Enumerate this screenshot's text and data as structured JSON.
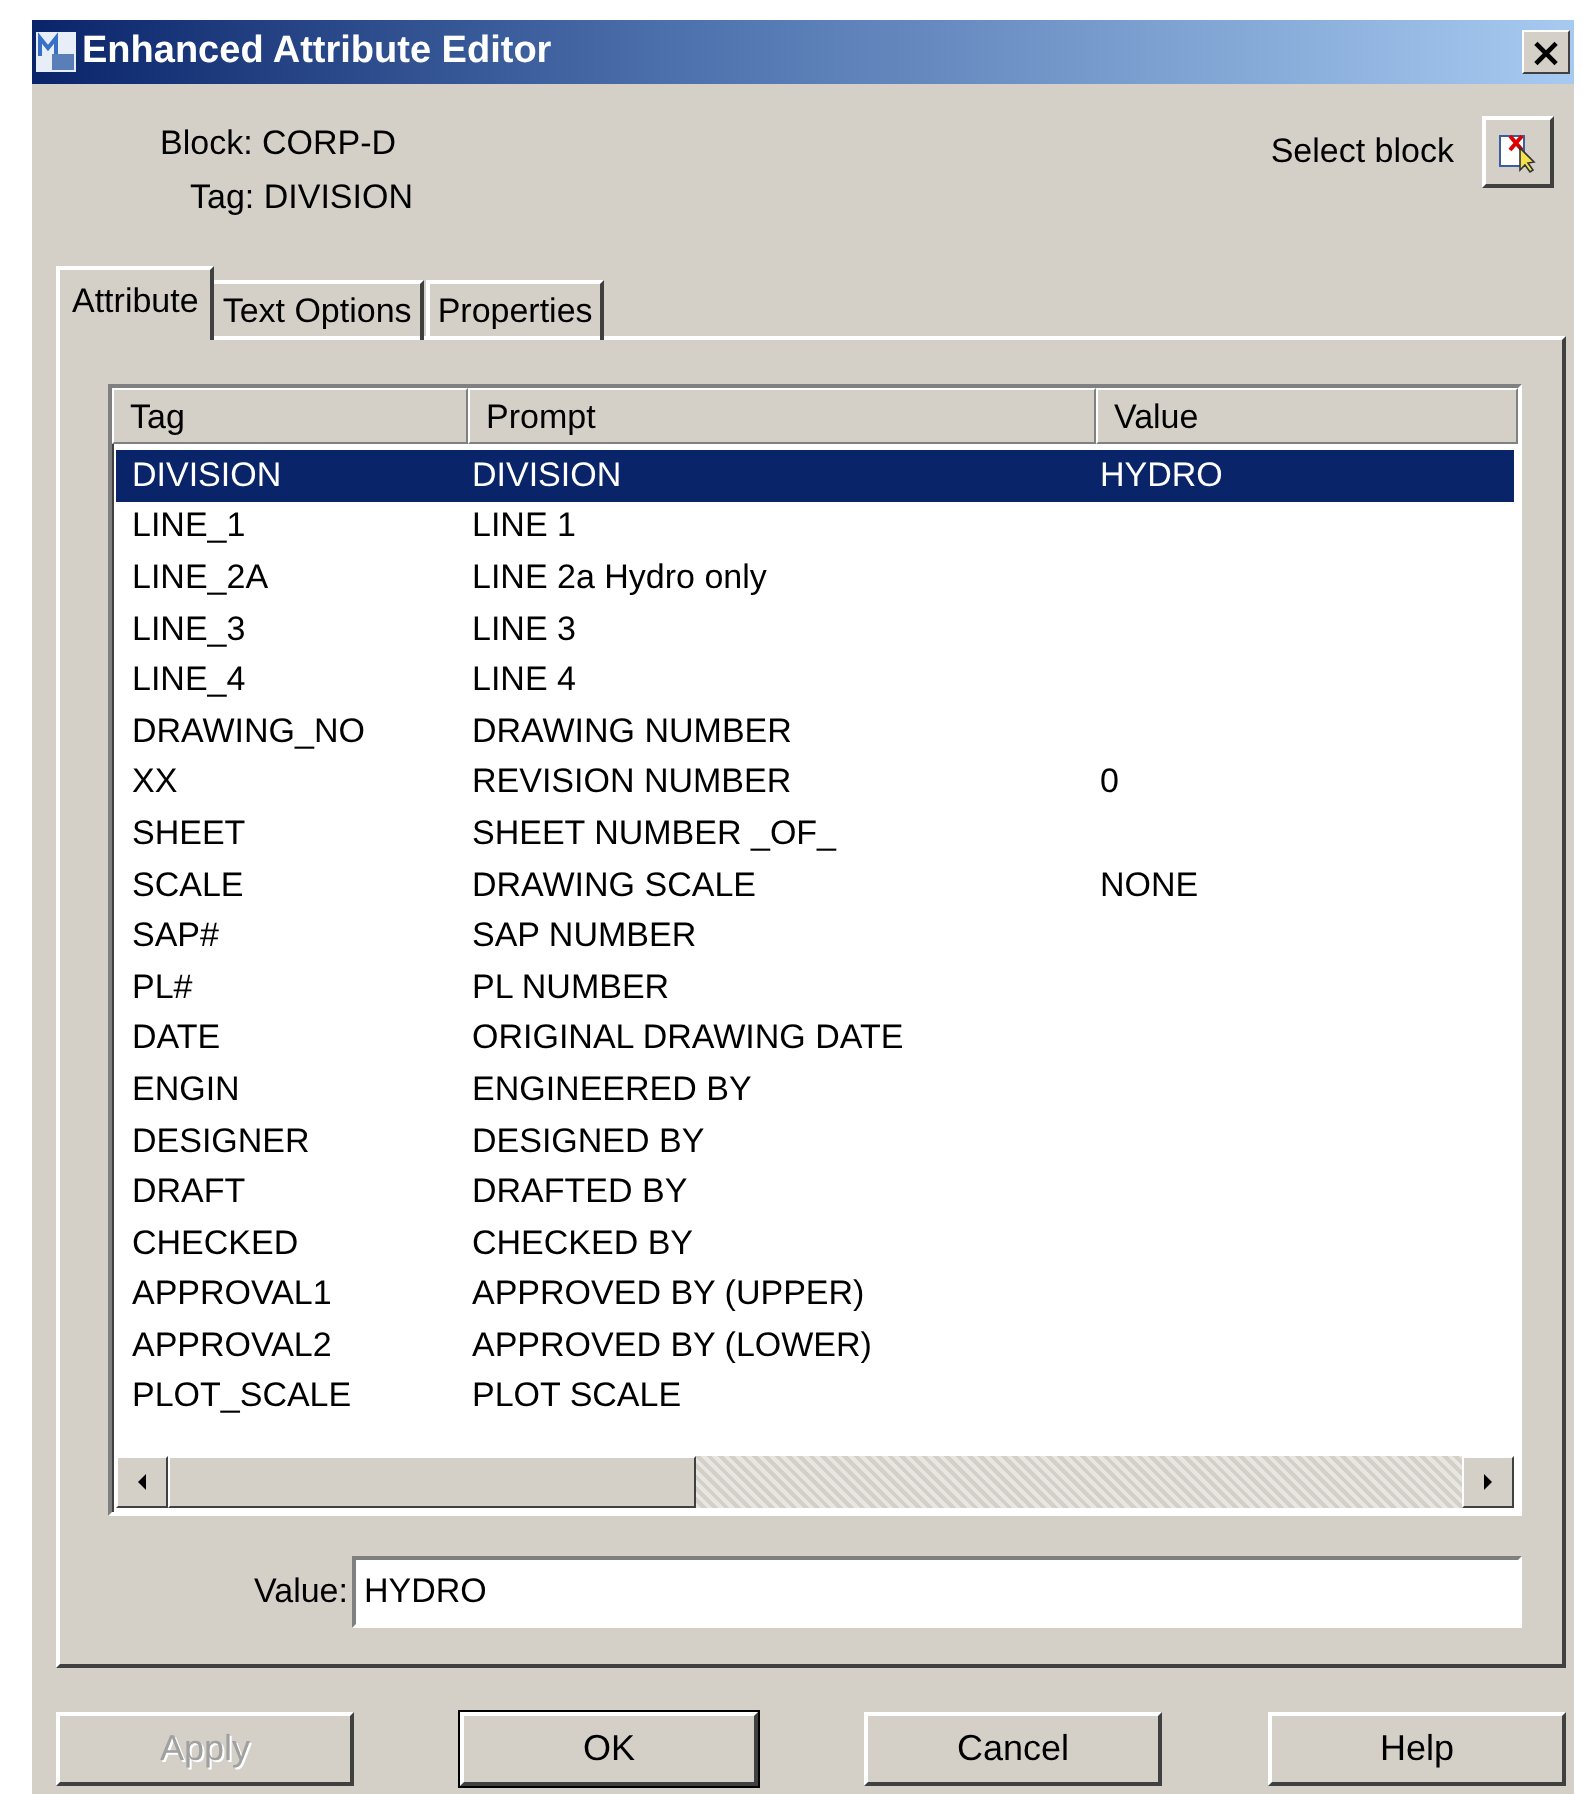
{
  "window": {
    "title": "Enhanced Attribute Editor",
    "close": "×"
  },
  "block": {
    "block_label": "Block: CORP-D",
    "tag_label": "Tag: DIVISION"
  },
  "select_block": {
    "label": "Select block"
  },
  "tabs": [
    {
      "label": "Attribute",
      "selected": true
    },
    {
      "label": "Text Options",
      "selected": false
    },
    {
      "label": "Properties",
      "selected": false
    }
  ],
  "table": {
    "columns": [
      "Tag",
      "Prompt",
      "Value"
    ],
    "rows": [
      {
        "tag": "DIVISION",
        "prompt": "DIVISION",
        "value": "HYDRO",
        "selected": true
      },
      {
        "tag": "LINE_1",
        "prompt": "LINE 1",
        "selected": false
      },
      {
        "tag": "LINE_2A",
        "prompt": "LINE 2a Hydro only",
        "selected": false
      },
      {
        "tag": "LINE_3",
        "prompt": "LINE 3",
        "selected": false
      },
      {
        "tag": "LINE_4",
        "prompt": "LINE 4",
        "selected": false
      },
      {
        "tag": "DRAWING_NO",
        "prompt": "DRAWING NUMBER",
        "selected": false
      },
      {
        "tag": "XX",
        "prompt": "REVISION NUMBER",
        "value": "0",
        "selected": false
      },
      {
        "tag": "SHEET",
        "prompt": "SHEET NUMBER _OF_",
        "selected": false
      },
      {
        "tag": "SCALE",
        "prompt": "DRAWING SCALE",
        "value": "NONE",
        "selected": false
      },
      {
        "tag": "SAP#",
        "prompt": "SAP NUMBER",
        "selected": false
      },
      {
        "tag": "PL#",
        "prompt": "PL NUMBER",
        "selected": false
      },
      {
        "tag": "DATE",
        "prompt": "ORIGINAL DRAWING DATE",
        "selected": false
      },
      {
        "tag": "ENGIN",
        "prompt": "ENGINEERED BY",
        "selected": false
      },
      {
        "tag": "DESIGNER",
        "prompt": "DESIGNED BY",
        "selected": false
      },
      {
        "tag": "DRAFT",
        "prompt": "DRAFTED BY",
        "selected": false
      },
      {
        "tag": "CHECKED",
        "prompt": "CHECKED BY",
        "selected": false
      },
      {
        "tag": "APPROVAL1",
        "prompt": "APPROVED BY (UPPER)",
        "selected": false
      },
      {
        "tag": "APPROVAL2",
        "prompt": "APPROVED BY (LOWER)",
        "selected": false
      },
      {
        "tag": "PLOT_SCALE",
        "prompt": "PLOT SCALE",
        "selected": false
      }
    ]
  },
  "value_field": {
    "label": "Value:",
    "value": "HYDRO"
  },
  "buttons": [
    {
      "label": "Apply",
      "disabled": true,
      "default": false
    },
    {
      "label": "OK",
      "disabled": false,
      "default": true
    },
    {
      "label": "Cancel",
      "disabled": false,
      "default": false
    },
    {
      "label": "Help",
      "disabled": false,
      "default": false
    }
  ]
}
